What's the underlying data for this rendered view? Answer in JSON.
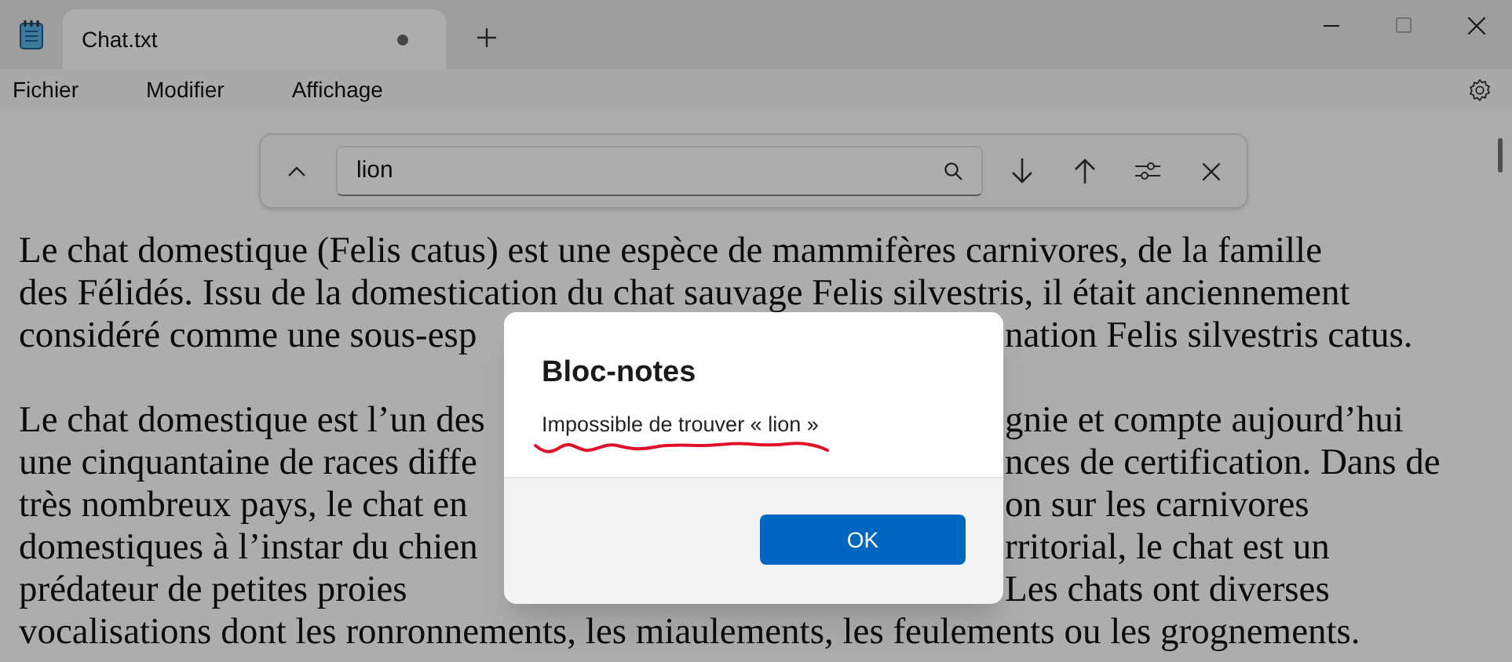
{
  "tabs": [
    {
      "label": "Chat.txt",
      "selected": true,
      "modified": true
    }
  ],
  "menu": [
    "Fichier",
    "Modifier",
    "Affichage"
  ],
  "find_bar": {
    "value": "lion"
  },
  "document": {
    "paragraphs": [
      [
        {
          "kind": "full",
          "text": "Le chat domestique (Felis catus) est une espèce de mammifères carnivores, de la famille"
        },
        {
          "kind": "full",
          "text": "des Félidés. Issu de la domestication du chat sauvage Felis silvestris, il était anciennement"
        },
        {
          "kind": "split",
          "left": "considéré comme une sous-esp",
          "right": "nation Felis silvestris catus."
        }
      ],
      [
        {
          "kind": "split",
          "left": "Le chat domestique est l’un des",
          "right": "gnie et compte aujourd’hui"
        },
        {
          "kind": "split",
          "left": "une cinquantaine de races diffe",
          "right": "nces de certification. Dans de"
        },
        {
          "kind": "split",
          "left": "très nombreux pays, le chat en",
          "right": "on sur les carnivores"
        },
        {
          "kind": "split",
          "left": "domestiques à l’instar du chien",
          "right": "rritorial, le chat est un"
        },
        {
          "kind": "split",
          "left": "prédateur de petites proies",
          "right": "Les chats ont diverses"
        },
        {
          "kind": "full",
          "text": "vocalisations dont les ronronnements, les miaulements, les feulements ou les grognements."
        }
      ]
    ]
  },
  "dialog": {
    "title": "Bloc-notes",
    "message": "Impossible de trouver « lion »",
    "button": "OK"
  }
}
